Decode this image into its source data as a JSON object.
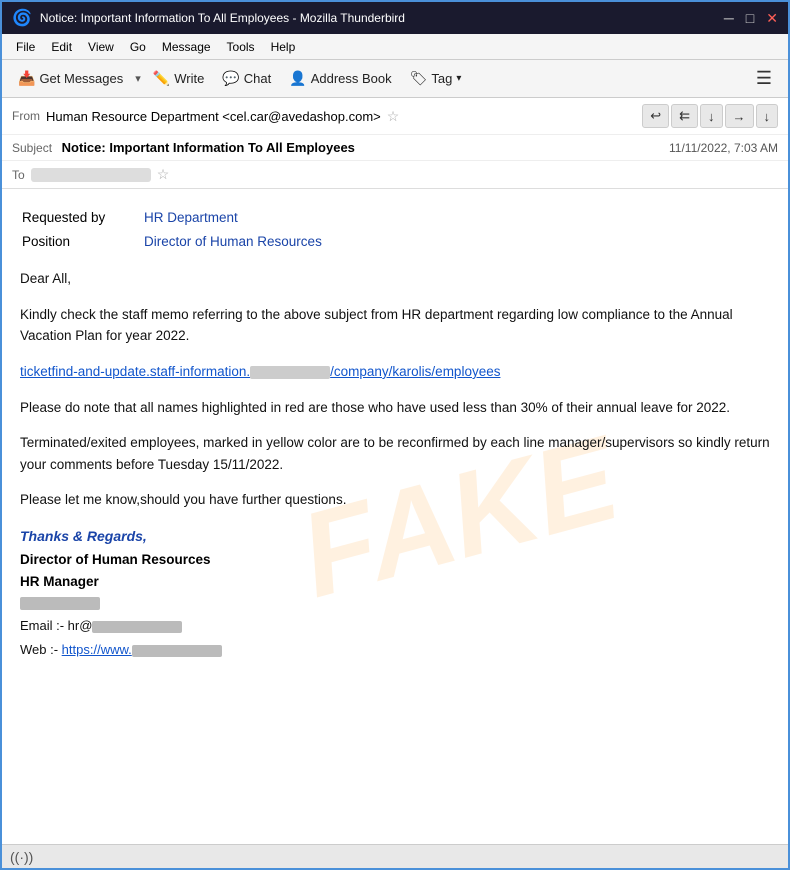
{
  "titlebar": {
    "title": "Notice: Important Information To All Employees - Mozilla Thunderbird",
    "icon": "🌐",
    "controls": [
      "─",
      "□",
      "✕"
    ]
  },
  "menubar": {
    "items": [
      "File",
      "Edit",
      "View",
      "Go",
      "Message",
      "Tools",
      "Help"
    ]
  },
  "toolbar": {
    "get_messages_label": "Get Messages",
    "write_label": "Write",
    "chat_label": "Chat",
    "address_book_label": "Address Book",
    "tag_label": "Tag",
    "menu_icon": "☰"
  },
  "email_header": {
    "from_label": "From",
    "from_value": "Human Resource Department <cel.car@avedashop.com>",
    "star": "☆",
    "subject_label": "Subject",
    "subject_value": "Notice: Important Information To All Employees",
    "date": "11/11/2022, 7:03 AM",
    "to_label": "To",
    "to_value": "",
    "action_buttons": [
      "↩",
      "⇇",
      "↓",
      "→",
      "↓"
    ]
  },
  "email_body": {
    "watermark": "FAKE",
    "requested_by_label": "Requested by",
    "requested_by_value": ": HR Department",
    "position_label": "Position",
    "position_value": ": Director of Human Resources",
    "greeting": "Dear All,",
    "paragraph1": "Kindly check the staff memo referring to the above subject from HR department regarding low compliance to the Annual Vacation Plan for year 2022.",
    "link_text": "ticketfind-and-update.staff-information.",
    "link_middle": "██████████",
    "link_end": "/company/karolis/employees",
    "paragraph2": "Please do note that all names highlighted in red are those who have used less than 30% of their annual leave for 2022.",
    "paragraph3": "Terminated/exited employees, marked in yellow color are to be reconfirmed by each line manager/supervisors so kindly return your comments before Tuesday 15/11/2022.",
    "paragraph4": "Please let me know,should you have further questions.",
    "signature": {
      "thanks": "Thanks & Regards,",
      "title1": "Director of Human Resources",
      "title2": "HR Manager",
      "phone_blurred": true,
      "email_label": "Email  :-",
      "email_value": "hr@",
      "email_blurred": true,
      "web_label": "Web    :-",
      "web_value": "https://www.",
      "web_blurred": true
    }
  },
  "statusbar": {
    "wifi_icon": "((·))"
  }
}
